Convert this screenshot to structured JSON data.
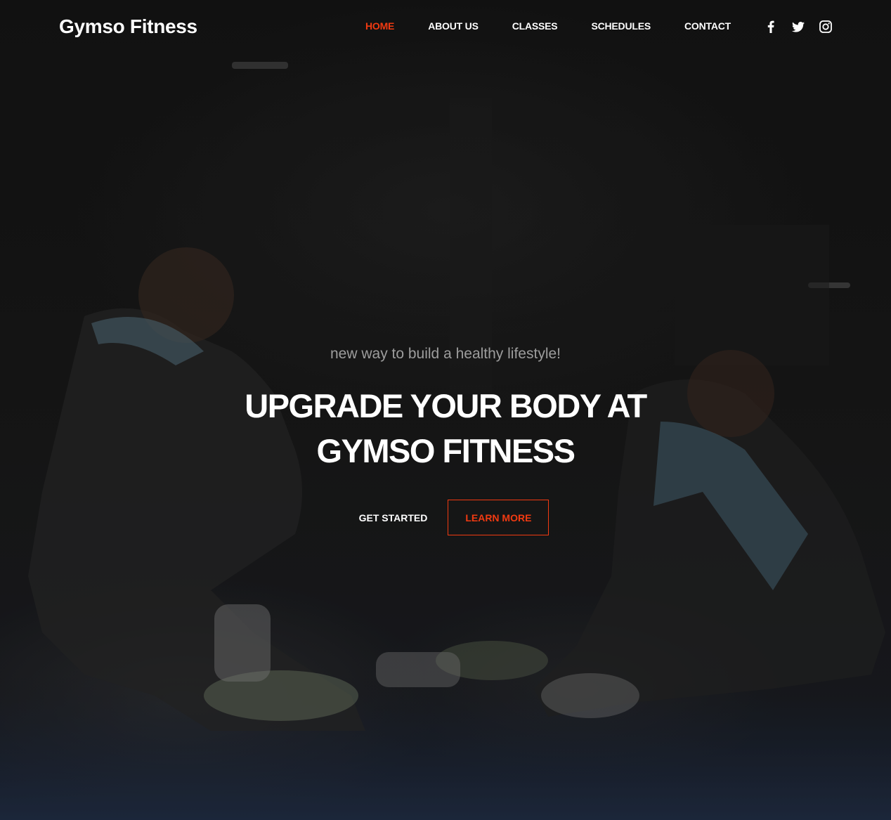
{
  "brand": {
    "name": "Gymso Fitness"
  },
  "nav": {
    "items": [
      {
        "label": "Home"
      },
      {
        "label": "About Us"
      },
      {
        "label": "Classes"
      },
      {
        "label": "Schedules"
      },
      {
        "label": "Contact"
      }
    ],
    "active_index": 0
  },
  "social": {
    "icons": [
      "facebook-icon",
      "twitter-icon",
      "instagram-icon"
    ]
  },
  "hero": {
    "subtitle": "new way to build a healthy lifestyle!",
    "headline": "Upgrade your body at Gymso Fitness",
    "primary_cta": "Get started",
    "secondary_cta": "Learn more"
  },
  "colors": {
    "accent": "#f13a11",
    "text": "#ffffff",
    "subtitle": "#9d9d9d",
    "background": "#171717"
  }
}
